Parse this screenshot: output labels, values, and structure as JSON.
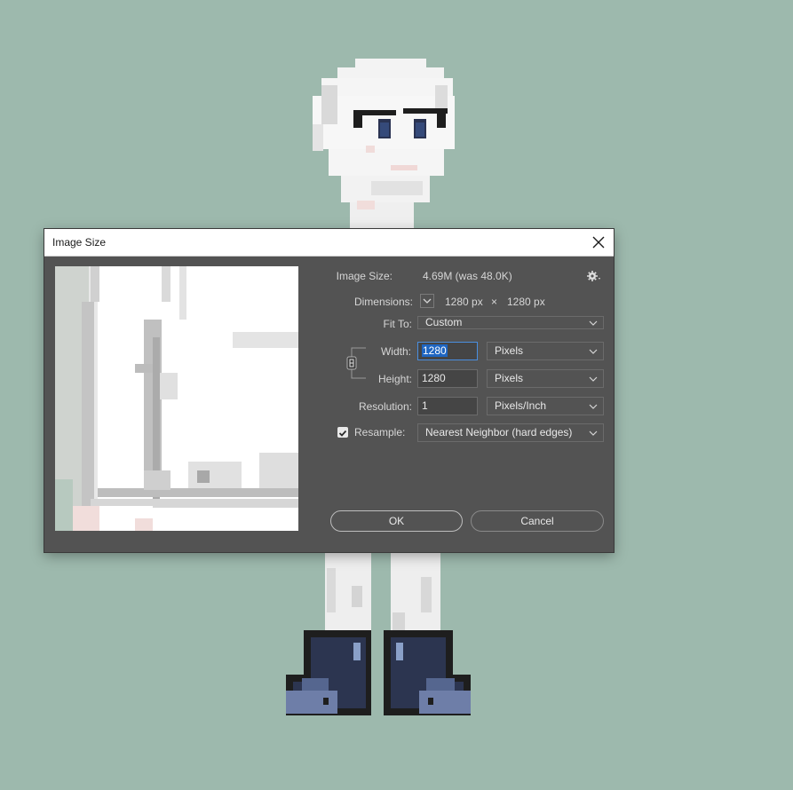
{
  "dialog": {
    "title": "Image Size",
    "image_size_label": "Image Size:",
    "image_size_value": "4.69M (was 48.0K)",
    "dimensions_label": "Dimensions:",
    "dimensions_width": "1280 px",
    "dimensions_separator": "×",
    "dimensions_height": "1280 px",
    "fit_to_label": "Fit To:",
    "fit_to_value": "Custom",
    "width_label": "Width:",
    "width_value": "1280",
    "width_unit": "Pixels",
    "height_label": "Height:",
    "height_value": "1280",
    "height_unit": "Pixels",
    "resolution_label": "Resolution:",
    "resolution_value": "1",
    "resolution_unit": "Pixels/Inch",
    "resample_label": "Resample:",
    "resample_checked": true,
    "resample_method": "Nearest Neighbor (hard edges)",
    "ok_label": "OK",
    "cancel_label": "Cancel"
  },
  "colors": {
    "canvas_bg": "#9db9ad",
    "dialog_bg": "#535353",
    "selection": "#1f66c2",
    "focus_border": "#4a8fe0"
  },
  "icons": [
    "close-icon",
    "gear-icon",
    "chevron-down-icon",
    "link-chain-icon",
    "checkmark-icon"
  ]
}
